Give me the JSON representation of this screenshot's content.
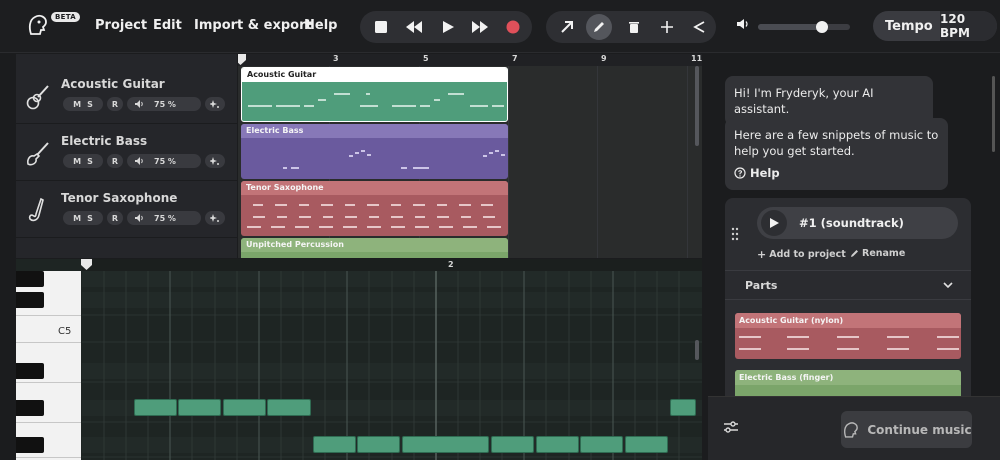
{
  "header": {
    "badge": "BETA",
    "menu": [
      "Project",
      "Edit",
      "Import & export",
      "Help"
    ],
    "tempo_label": "Tempo",
    "tempo_value": "120 BPM",
    "volume_level": 0.7
  },
  "transport_icons": [
    "stop-icon",
    "rewind-icon",
    "play-icon",
    "fast-forward-icon",
    "record-icon"
  ],
  "tool_icons": [
    "pointer-tool-icon",
    "pencil-tool-icon",
    "trash-tool-icon",
    "split-tool-icon",
    "share-icon"
  ],
  "tracks": [
    {
      "name": "Acoustic Guitar",
      "mute": "M",
      "solo": "S",
      "rec": "R",
      "volume": "75 %",
      "icon": "acoustic-guitar-icon"
    },
    {
      "name": "Electric Bass",
      "mute": "M",
      "solo": "S",
      "rec": "R",
      "volume": "75 %",
      "icon": "electric-bass-icon"
    },
    {
      "name": "Tenor Saxophone",
      "mute": "M",
      "solo": "S",
      "rec": "R",
      "volume": "75 %",
      "icon": "saxophone-icon"
    }
  ],
  "arrangement": {
    "bar_numbers": [
      "3",
      "5",
      "7",
      "9",
      "11"
    ],
    "clips": [
      {
        "label": "Acoustic Guitar",
        "color": "#4f9d7b",
        "head_color": "#ffffff"
      },
      {
        "label": "Electric Bass",
        "color": "#6a5a9e",
        "head_color": "#8778b8"
      },
      {
        "label": "Tenor Saxophone",
        "color": "#a85a60",
        "head_color": "#c27478"
      },
      {
        "label": "Unpitched Percussion",
        "color": "#7ba56a",
        "head_color": "#8eb37c"
      }
    ]
  },
  "piano_roll": {
    "bar_label": "2",
    "key_label": "C5"
  },
  "chat": {
    "greeting": "Hi! I'm Fryderyk, your AI assistant.",
    "intro": "Here are a few snippets of music to help you get started.",
    "help": "Help",
    "snippet_title": "#1 (soundtrack)",
    "add_to_project": "Add to project",
    "rename": "Rename",
    "parts_label": "Parts",
    "parts": [
      {
        "label": "Acoustic Guitar (nylon)",
        "color": "#a85a60",
        "head_color": "#c27478"
      },
      {
        "label": "Electric Bass (finger)",
        "color": "#7ba56a",
        "head_color": "#8eb37c"
      }
    ],
    "continue_label": "Continue music"
  }
}
